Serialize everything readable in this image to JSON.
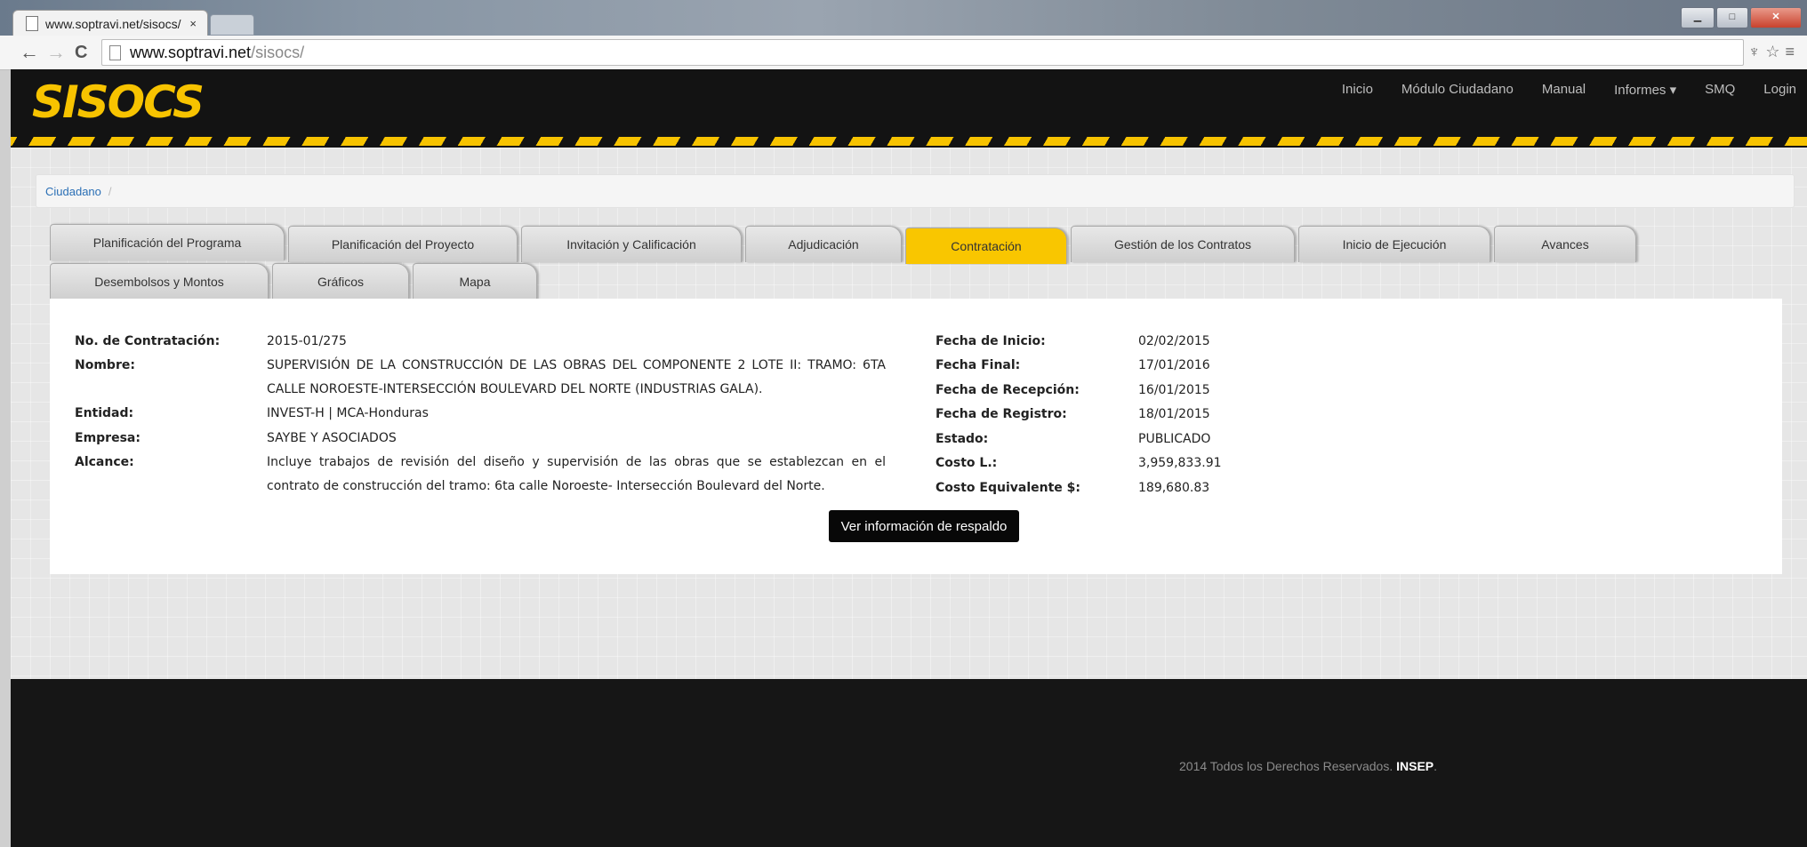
{
  "browser": {
    "tab_title": "www.soptravi.net/sisocs/",
    "tab_close": "×",
    "url_host": "www.soptravi.net",
    "url_path": "/sisocs/",
    "back": "←",
    "forward": "→",
    "reload": "C",
    "right_icons": "♆☆≡",
    "win_min": "▁",
    "win_max": "□",
    "win_close": "✕"
  },
  "header": {
    "logo": "SISOCS",
    "nav": [
      "Inicio",
      "Módulo Ciudadano",
      "Manual",
      "Informes ▾",
      "SMQ",
      "Login"
    ]
  },
  "breadcrumb": {
    "item": "Ciudadano",
    "sep": "/"
  },
  "tabs": {
    "row1": [
      "Planificación del Programa",
      "Planificación del Proyecto",
      "Invitación y Calificación",
      "Adjudicación",
      "Contratación",
      "Gestión de los Contratos",
      "Inicio de Ejecución",
      "Avances"
    ],
    "row2": [
      "Desembolsos y Montos",
      "Gráficos",
      "Mapa"
    ],
    "active": "Contratación"
  },
  "details": {
    "left": [
      {
        "label": "No. de Contratación:",
        "value": "2015-01/275"
      },
      {
        "label": "Nombre:",
        "value": "SUPERVISIÓN DE LA CONSTRUCCIÓN DE LAS OBRAS DEL COMPONENTE 2 LOTE II: TRAMO: 6TA CALLE NOROESTE-INTERSECCIÓN BOULEVARD DEL NORTE (INDUSTRIAS GALA)."
      },
      {
        "label": "Entidad:",
        "value": "INVEST-H | MCA-Honduras"
      },
      {
        "label": "Empresa:",
        "value": "SAYBE Y ASOCIADOS"
      },
      {
        "label": "Alcance:",
        "value": "Incluye trabajos de revisión del diseño y supervisión de las obras que se establezcan en el contrato de construcción del tramo: 6ta calle Noroeste- Intersección Boulevard del Norte."
      }
    ],
    "right": [
      {
        "label": "Fecha de Inicio:",
        "value": "02/02/2015"
      },
      {
        "label": "Fecha Final:",
        "value": "17/01/2016"
      },
      {
        "label": "Fecha de Recepción:",
        "value": "16/01/2015"
      },
      {
        "label": "Fecha de Registro:",
        "value": "18/01/2015"
      },
      {
        "label": "Estado:",
        "value": "PUBLICADO"
      },
      {
        "label": "Costo L.:",
        "value": "3,959,833.91"
      },
      {
        "label": "Costo Equivalente $:",
        "value": "189,680.83"
      }
    ],
    "button": "Ver información de respaldo"
  },
  "footer": {
    "text": "2014 Todos los Derechos Reservados.",
    "brand": "INSEP",
    "end": "."
  }
}
